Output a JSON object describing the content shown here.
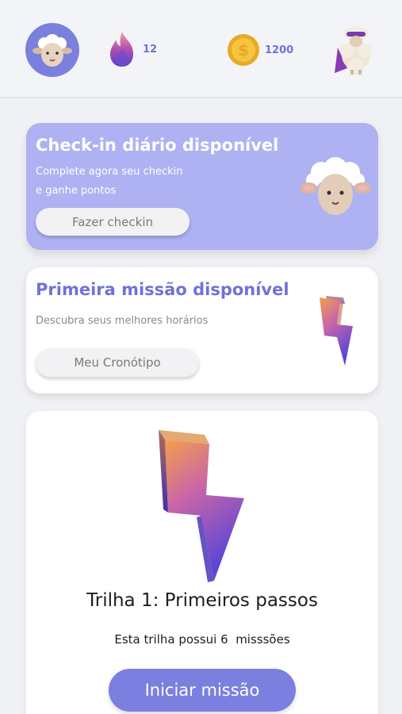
{
  "header": {
    "streak": {
      "icon": "flame-icon",
      "value": "12"
    },
    "coins": {
      "icon": "coin-icon",
      "value": "1200"
    },
    "avatar_icon": "sheep-avatar-icon",
    "mascot_icon": "hero-sheep-icon"
  },
  "checkin": {
    "title": "Check-in diário disponível",
    "line1": "Complete agora seu checkin",
    "line2": "e ganhe pontos",
    "button": "Fazer checkin"
  },
  "mission": {
    "title": "Primeira missão disponível",
    "subtitle": "Descubra seus melhores horários",
    "button": "Meu Cronótipo"
  },
  "trail": {
    "title": "Trilha 1: Primeiros passos",
    "subtitle": "Esta trilha possui 6  misssões",
    "button": "Iniciar missão"
  },
  "colors": {
    "accent": "#7b7fe0",
    "checkin_card": "#aeb2f2",
    "title_purple": "#6f73d6"
  }
}
